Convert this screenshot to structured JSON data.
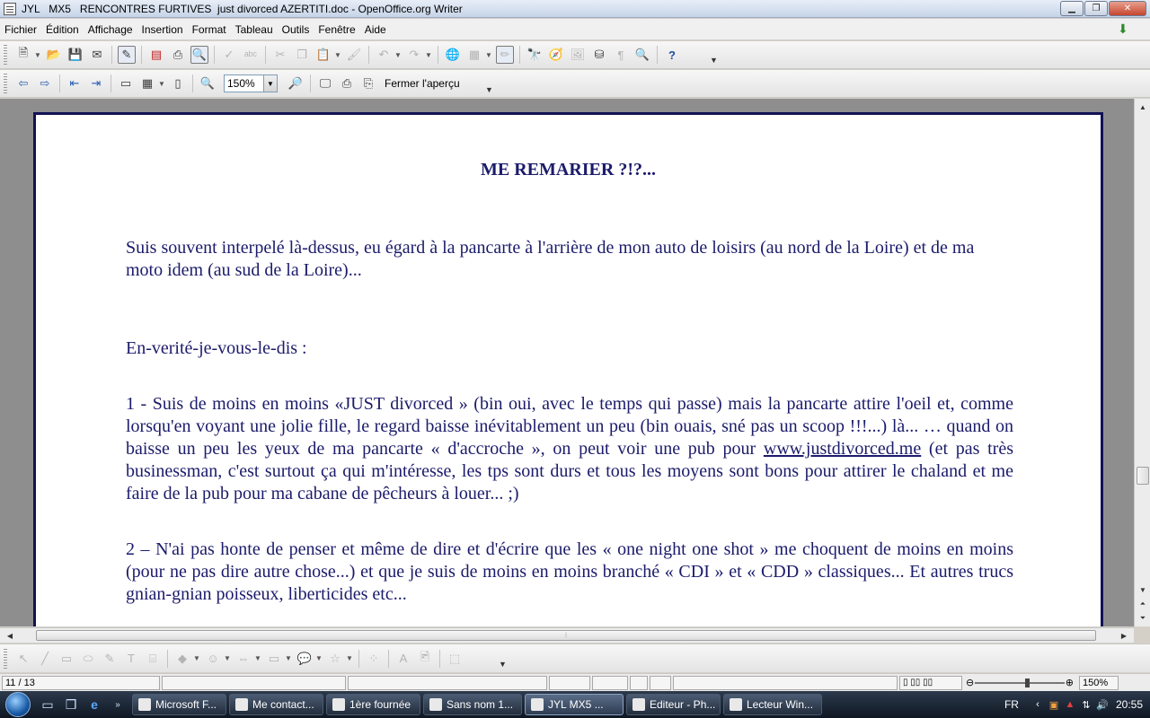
{
  "window": {
    "title": "JYL   MX5   RENCONTRES FURTIVES  just divorced AZERTITI.doc - OpenOffice.org Writer"
  },
  "menu": {
    "items": [
      {
        "label": "Fichier"
      },
      {
        "label": "Édition"
      },
      {
        "label": "Affichage"
      },
      {
        "label": "Insertion"
      },
      {
        "label": "Format"
      },
      {
        "label": "Tableau"
      },
      {
        "label": "Outils"
      },
      {
        "label": "Fenêtre"
      },
      {
        "label": "Aide"
      }
    ]
  },
  "preview_toolbar": {
    "zoom_value": "150%",
    "close_preview_label": "Fermer l'aperçu"
  },
  "document": {
    "title": "ME REMARIER ?!?...",
    "paragraphs": [
      "Suis souvent interpelé là-dessus, eu égard à la pancarte à l'arrière de mon auto de loisirs (au nord de la Loire) et de ma moto idem (au sud de la Loire)...",
      "En-verité-je-vous-le-dis :",
      "1 - Suis de moins en moins «JUST divorced » (bin oui, avec le temps qui passe) mais la pancarte attire l'oeil et, comme lorsqu'en voyant une jolie fille, le regard baisse inévitablement un peu  (bin ouais, sné pas un scoop !!!...) là... … quand on baisse un peu les yeux de ma pancarte « d'accroche », on peut voir une pub pour",
      "  (et pas très businessman, c'est surtout ça qui m'intéresse, les tps sont durs et tous les moyens sont bons pour attirer le chaland et me faire de la pub pour ma cabane de pêcheurs à louer...  ;)",
      "2 – N'ai pas honte de penser et même de dire et d'écrire que les « one night one shot » me choquent de moins en moins (pour ne pas dire autre chose...) et que je suis de moins en moins branché « CDI » et « CDD » classiques... Et autres trucs gnian-gnian poisseux, liberticides etc..."
    ],
    "link_text": "www.justdivorced.me"
  },
  "statusbar": {
    "page": "11 / 13",
    "zoom": "150%"
  },
  "taskbar": {
    "tasks": [
      {
        "label": "Microsoft F..."
      },
      {
        "label": "Me contact..."
      },
      {
        "label": "1ère fournée"
      },
      {
        "label": "Sans nom 1..."
      },
      {
        "label": "JYL   MX5   ..."
      },
      {
        "label": "Editeur - Ph..."
      },
      {
        "label": "Lecteur Win..."
      }
    ],
    "language": "FR",
    "clock": "20:55"
  }
}
